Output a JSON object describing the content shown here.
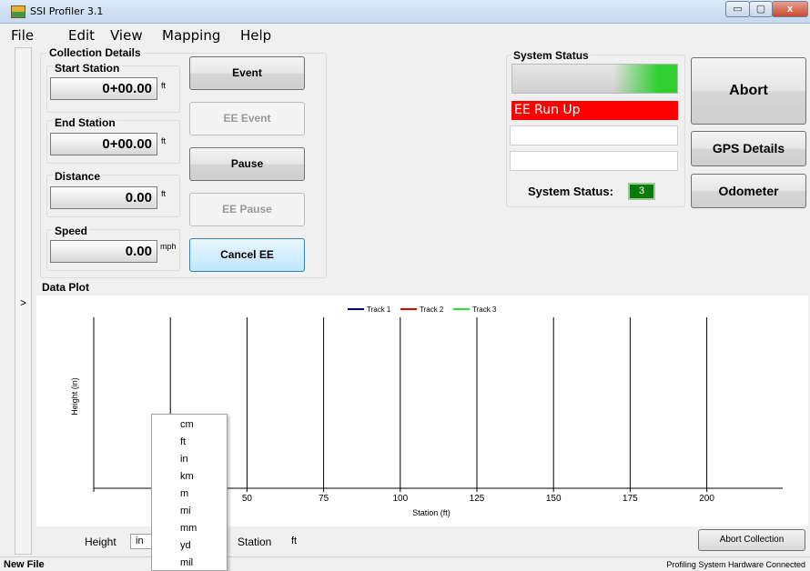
{
  "window": {
    "title": "SSI Profiler 3.1",
    "minimize": "▭",
    "maximize": "▢",
    "close": "x"
  },
  "menu": [
    "File",
    "Edit",
    "View",
    "Mapping",
    "Help"
  ],
  "side_toggle": ">",
  "collection": {
    "title": "Collection Details",
    "start_station": {
      "label": "Start Station",
      "value": "0+00.00",
      "unit": "ft"
    },
    "end_station": {
      "label": "End Station",
      "value": "0+00.00",
      "unit": "ft"
    },
    "distance": {
      "label": "Distance",
      "value": "0.00",
      "unit": "ft"
    },
    "speed": {
      "label": "Speed",
      "value": "0.00",
      "unit": "mph"
    }
  },
  "buttons": {
    "event": "Event",
    "ee_event": "EE Event",
    "pause": "Pause",
    "ee_pause": "EE Pause",
    "cancel_ee": "Cancel EE",
    "abort": "Abort",
    "gps_details": "GPS Details",
    "odometer": "Odometer",
    "abort_collection": "Abort Collection"
  },
  "system_status": {
    "title": "System Status",
    "message": "EE Run Up",
    "label": "System Status:",
    "count": "3",
    "colors": {
      "alert": "#ff0000",
      "ok": "#0a7a0a",
      "progress": "#30d030"
    }
  },
  "data_plot": {
    "title": "Data Plot",
    "legend": [
      "Track 1",
      "Track 2",
      "Track 3"
    ]
  },
  "chart_data": {
    "type": "line",
    "xlabel": "Station (ft)",
    "ylabel": "Height (in)",
    "xticks": [
      "50",
      "75",
      "100",
      "125",
      "150",
      "175",
      "200"
    ],
    "series": [
      {
        "name": "Track 1",
        "color": "#00008b",
        "values": []
      },
      {
        "name": "Track 2",
        "color": "#e00000",
        "values": []
      },
      {
        "name": "Track 3",
        "color": "#30e030",
        "values": []
      }
    ],
    "grid": "vertical"
  },
  "bottom": {
    "height_label": "Height",
    "height_unit": "in",
    "station_label": "Station",
    "station_unit": "ft"
  },
  "unit_options": [
    "cm",
    "ft",
    "in",
    "km",
    "m",
    "mi",
    "mm",
    "yd",
    "mil"
  ],
  "statusbar": {
    "file": "New File",
    "hardware": "Profiling System Hardware Connected"
  }
}
